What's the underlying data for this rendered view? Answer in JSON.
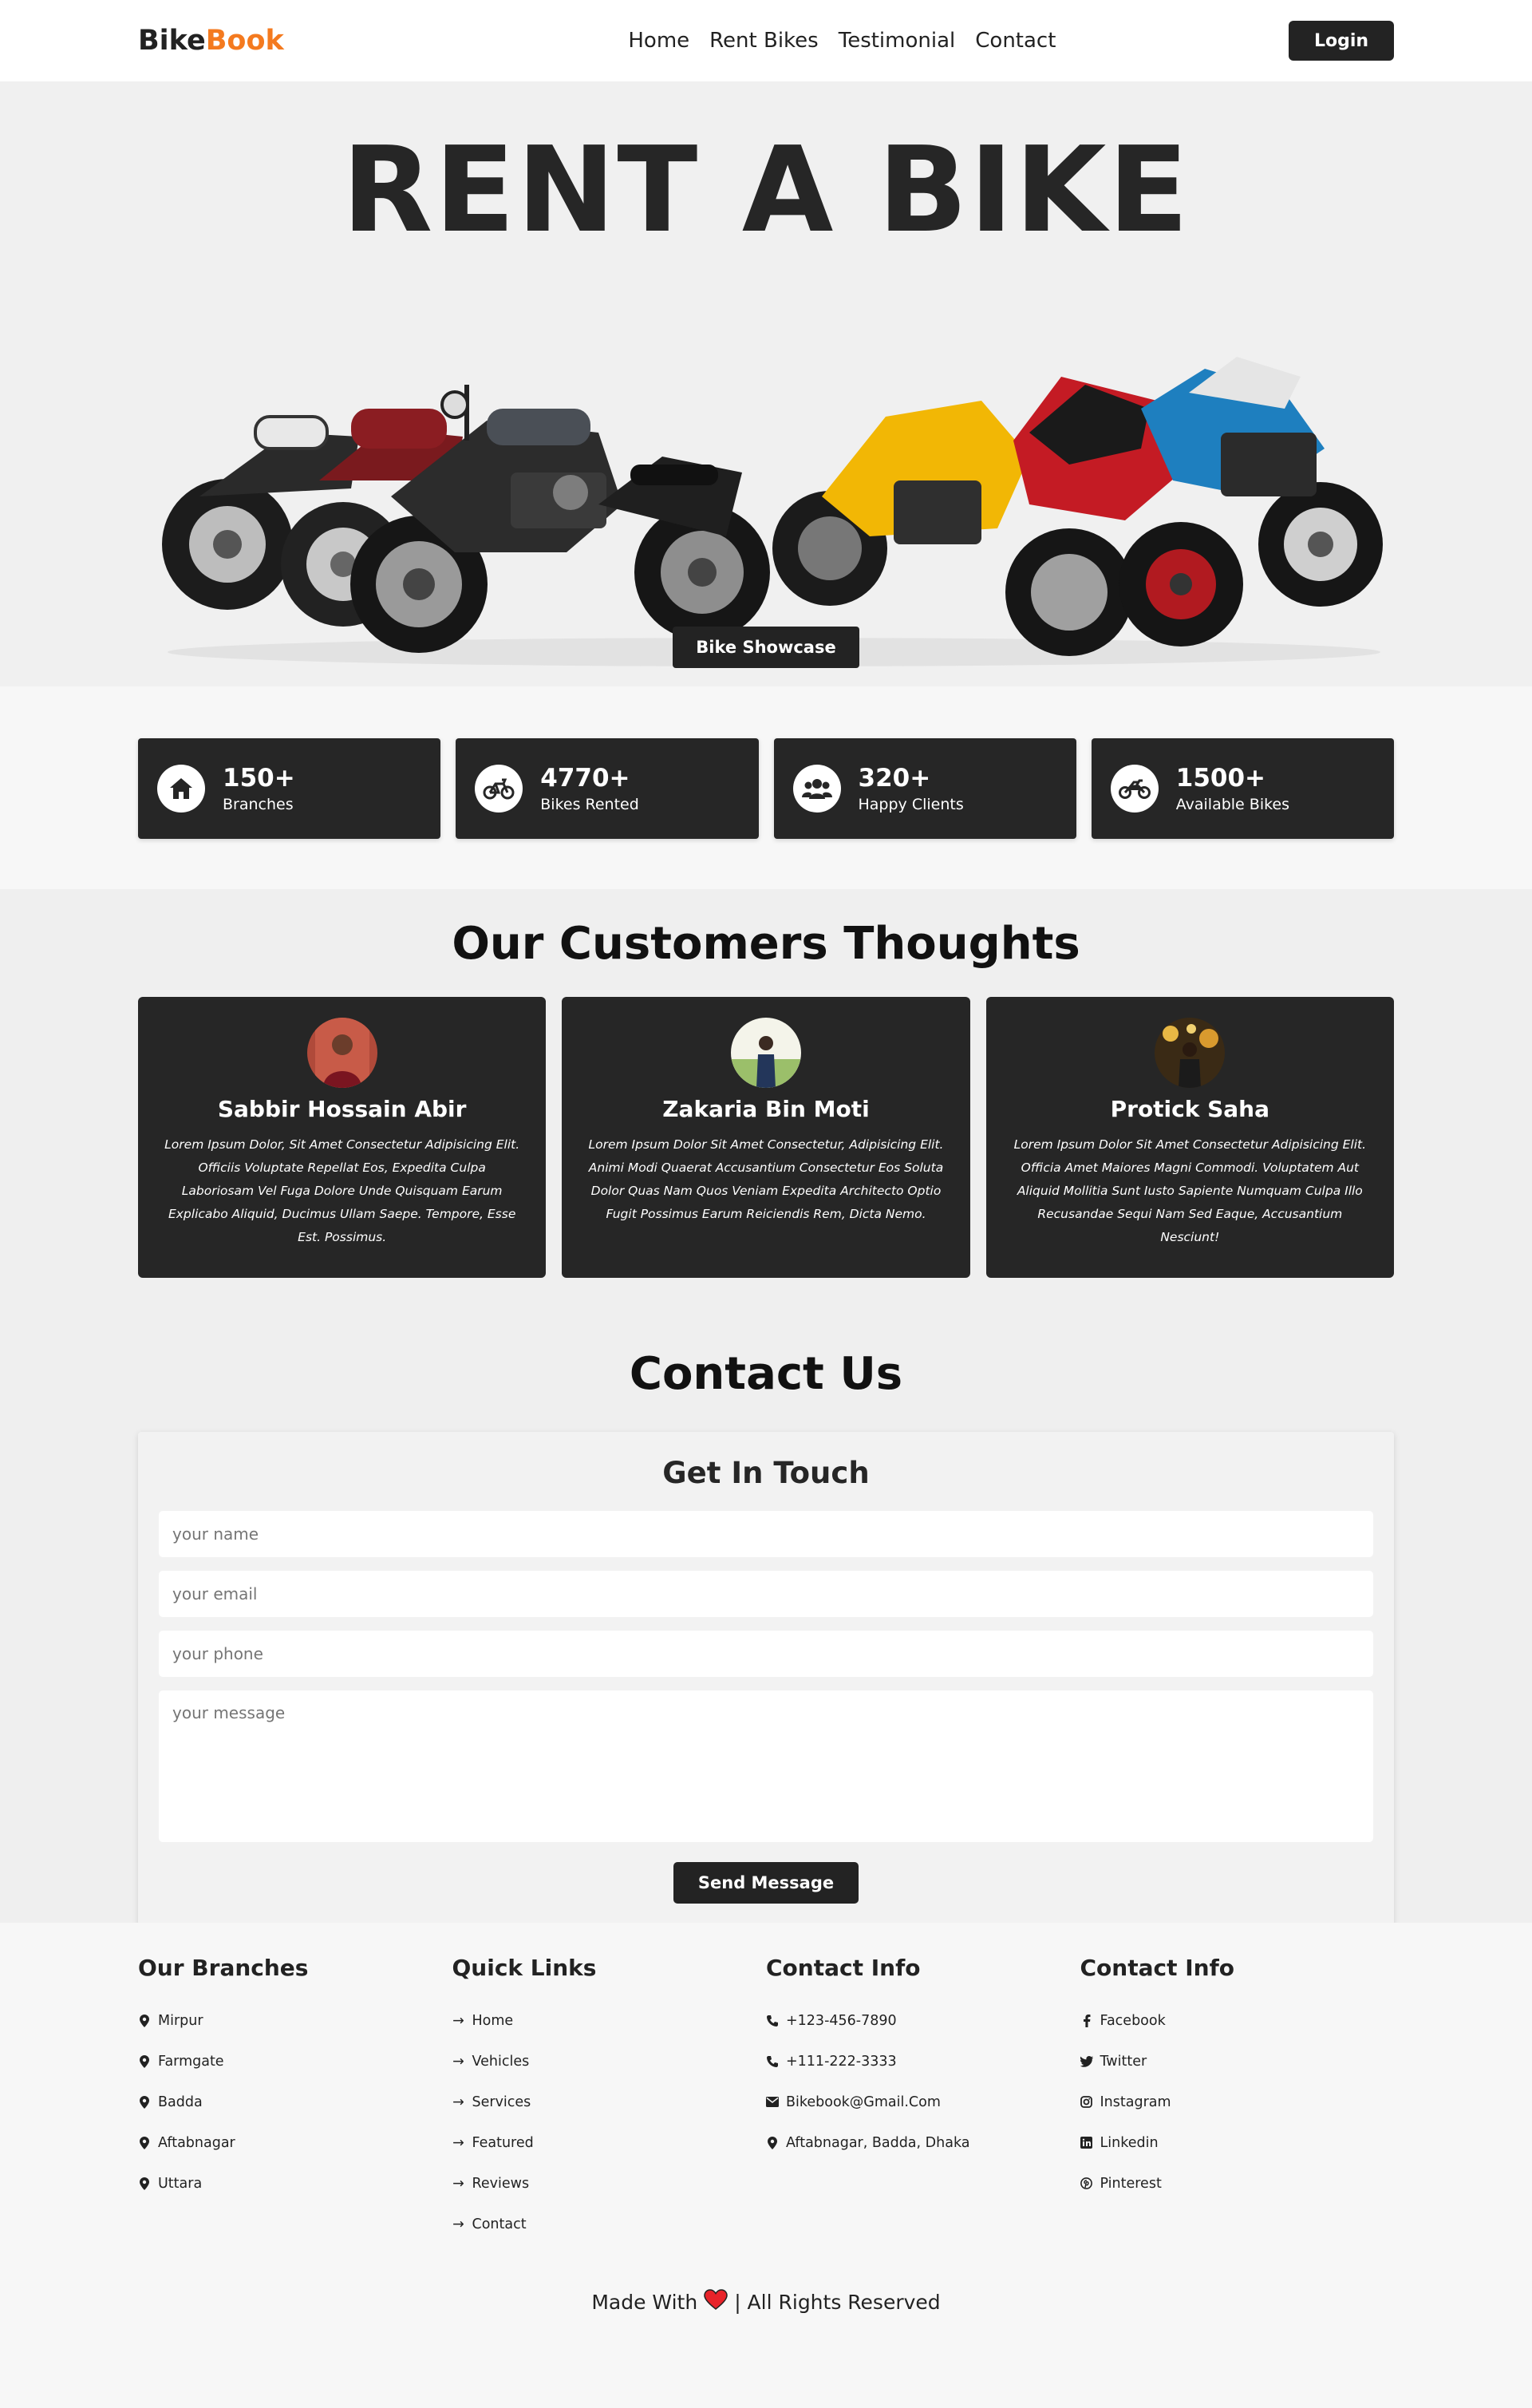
{
  "nav": {
    "logo_part1": "Bike",
    "logo_part2": "Book",
    "links": [
      "Home",
      "Rent Bikes",
      "Testimonial",
      "Contact"
    ],
    "login_label": "Login"
  },
  "hero": {
    "title": "RENT A BIKE",
    "button_label": "Bike Showcase"
  },
  "stats": [
    {
      "value": "150+",
      "label": "Branches",
      "icon": "home-icon"
    },
    {
      "value": "4770+",
      "label": "Bikes Rented",
      "icon": "bicycle-icon"
    },
    {
      "value": "320+",
      "label": "Happy Clients",
      "icon": "users-icon"
    },
    {
      "value": "1500+",
      "label": "Available Bikes",
      "icon": "motorcycle-icon"
    }
  ],
  "testimonials": {
    "heading_part1": "Our Customers",
    "heading_part2": "Thoughts",
    "items": [
      {
        "name": "Sabbir Hossain Abir",
        "text": "Lorem Ipsum Dolor, Sit Amet Consectetur Adipisicing Elit. Officiis Voluptate Repellat Eos, Expedita Culpa Laboriosam Vel Fuga Dolore Unde Quisquam Earum Explicabo Aliquid, Ducimus Ullam Saepe. Tempore, Esse Est. Possimus."
      },
      {
        "name": "Zakaria Bin Moti",
        "text": "Lorem Ipsum Dolor Sit Amet Consectetur, Adipisicing Elit. Animi Modi Quaerat Accusantium Consectetur Eos Soluta Dolor Quas Nam Quos Veniam Expedita Architecto Optio Fugit Possimus Earum Reiciendis Rem, Dicta Nemo."
      },
      {
        "name": "Protick Saha",
        "text": "Lorem Ipsum Dolor Sit Amet Consectetur Adipisicing Elit. Officia Amet Maiores Magni Commodi. Voluptatem Aut Aliquid Mollitia Sunt Iusto Sapiente Numquam Culpa Illo Recusandae Sequi Nam Sed Eaque, Accusantium Nesciunt!"
      }
    ]
  },
  "contact": {
    "heading_part1": "Contact",
    "heading_part2": "Us",
    "box_title": "Get In Touch",
    "name_placeholder": "your name",
    "email_placeholder": "your email",
    "phone_placeholder": "your phone",
    "message_placeholder": "your message",
    "send_label": "Send Message"
  },
  "footer": {
    "branches": {
      "title": "Our Branches",
      "items": [
        "Mirpur",
        "Farmgate",
        "Badda",
        "Aftabnagar",
        "Uttara"
      ]
    },
    "quick_links": {
      "title": "Quick Links",
      "items": [
        "Home",
        "Vehicles",
        "Services",
        "Featured",
        "Reviews",
        "Contact"
      ]
    },
    "contact_info": {
      "title": "Contact Info",
      "items": [
        {
          "icon": "phone-icon",
          "text": "+123-456-7890"
        },
        {
          "icon": "phone-icon",
          "text": "+111-222-3333"
        },
        {
          "icon": "envelope-icon",
          "text": "Bikebook@Gmail.Com"
        },
        {
          "icon": "map-marker-icon",
          "text": "Aftabnagar, Badda, Dhaka"
        }
      ]
    },
    "social": {
      "title": "Contact Info",
      "items": [
        {
          "icon": "facebook-icon",
          "text": "Facebook"
        },
        {
          "icon": "twitter-icon",
          "text": "Twitter"
        },
        {
          "icon": "instagram-icon",
          "text": "Instagram"
        },
        {
          "icon": "linkedin-icon",
          "text": "Linkedin"
        },
        {
          "icon": "pinterest-icon",
          "text": "Pinterest"
        }
      ]
    },
    "credit_left": "Made With",
    "credit_right": "| All Rights Reserved"
  },
  "colors": {
    "accent": "#f47a1f",
    "dark": "#262626"
  }
}
